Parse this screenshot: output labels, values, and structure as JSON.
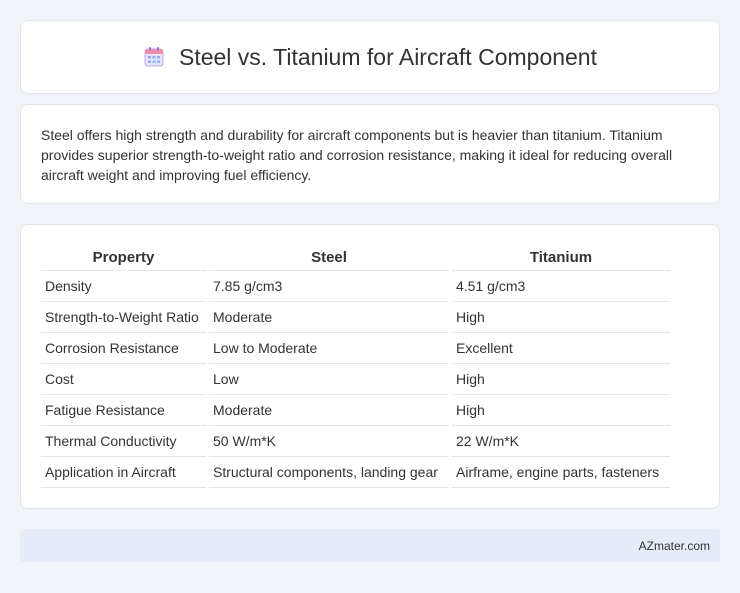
{
  "header": {
    "title": "Steel vs. Titanium for Aircraft Component",
    "icon": "calendar-icon"
  },
  "summary": {
    "text": "Steel offers high strength and durability for aircraft components but is heavier than titanium. Titanium provides superior strength-to-weight ratio and corrosion resistance, making it ideal for reducing overall aircraft weight and improving fuel efficiency."
  },
  "table": {
    "headers": [
      "Property",
      "Steel",
      "Titanium"
    ],
    "rows": [
      [
        "Density",
        "7.85 g/cm3",
        "4.51 g/cm3"
      ],
      [
        "Strength-to-Weight Ratio",
        "Moderate",
        "High"
      ],
      [
        "Corrosion Resistance",
        "Low to Moderate",
        "Excellent"
      ],
      [
        "Cost",
        "Low",
        "High"
      ],
      [
        "Fatigue Resistance",
        "Moderate",
        "High"
      ],
      [
        "Thermal Conductivity",
        "50 W/m*K",
        "22 W/m*K"
      ],
      [
        "Application in Aircraft",
        "Structural components, landing gear",
        "Airframe, engine parts, fasteners"
      ]
    ]
  },
  "footer": {
    "source": "AZmater.com"
  }
}
